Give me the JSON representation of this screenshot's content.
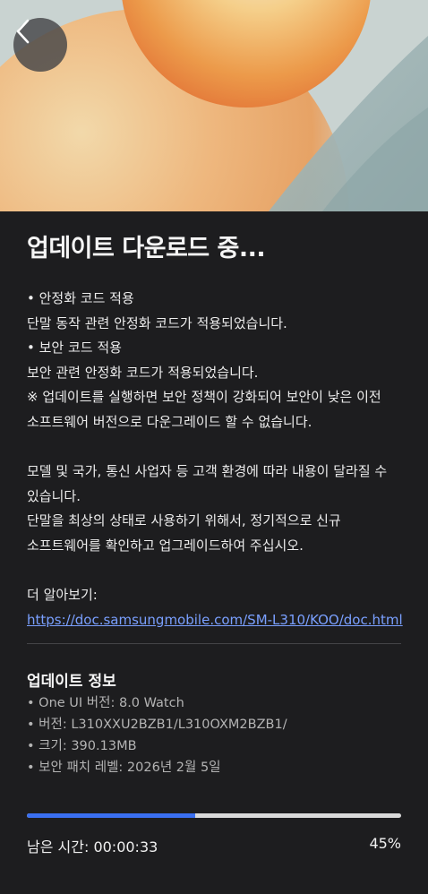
{
  "header": {
    "back_label": "Back"
  },
  "title": "업데이트 다운로드 중...",
  "release_notes": [
    "• 안정화 코드 적용",
    "단말 동작 관련 안정화 코드가 적용되었습니다.",
    "• 보안 코드 적용",
    "보안 관련 안정화 코드가 적용되었습니다.",
    "※ 업데이트를 실행하면 보안 정책이 강화되어 보안이 낮은 이전",
    "소프트웨어 버전으로 다운그레이드 할 수 없습니다.",
    "",
    "모델 및 국가, 통신 사업자 등 고객 환경에 따라 내용이 달라질 수",
    "있습니다.",
    "단말을 최상의 상태로 사용하기 위해서, 정기적으로 신규",
    "소프트웨어를 확인하고 업그레이드하여 주십시오.",
    "",
    "더 알아보기:"
  ],
  "learn_more_url": "https://doc.samsungmobile.com/SM-L310/KOO/doc.html",
  "update_info": {
    "title": "업데이트 정보",
    "items": [
      "• One UI 버전: 8.0 Watch",
      "• 버전: L310XXU2BZB1/L310OXM2BZB1/",
      "• 크기: 390.13MB",
      "• 보안 패치 레벨: 2026년 2월 5일"
    ]
  },
  "progress": {
    "fraction": 0.45,
    "remaining_label": "남은 시간: 00:00:33",
    "percent_label": "45%"
  },
  "colors": {
    "accent": "#3a6ff0",
    "background": "#1d1d1f",
    "link": "#7aa0ff"
  }
}
